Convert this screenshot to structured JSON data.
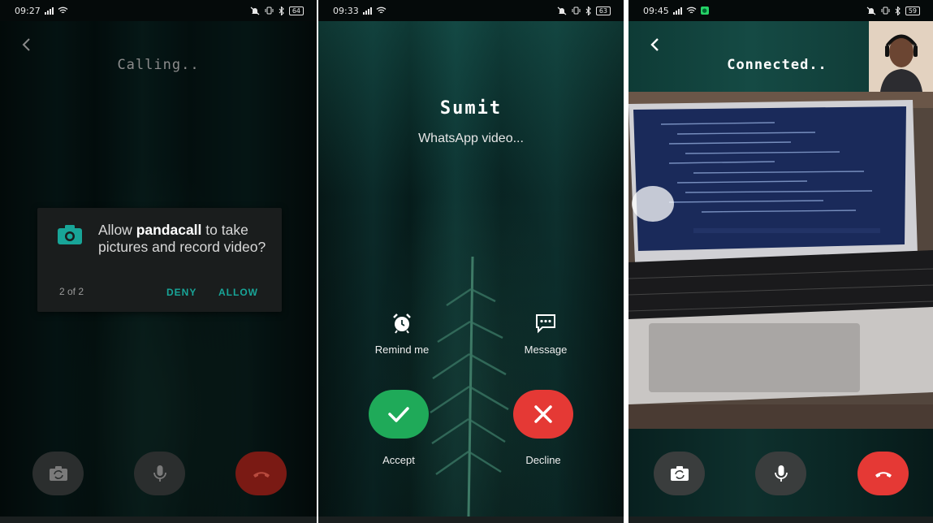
{
  "screens": [
    {
      "status": {
        "time": "09:27",
        "battery": "64"
      },
      "call_status": "Calling..",
      "permission_dialog": {
        "text_before": "Allow ",
        "app_name": "pandacall",
        "text_after": " to take pictures and record video?",
        "counter": "2 of 2",
        "deny_label": "DENY",
        "allow_label": "ALLOW"
      },
      "controls": [
        "flip-camera-icon",
        "microphone-icon",
        "end-call-icon"
      ]
    },
    {
      "status": {
        "time": "09:33",
        "battery": "63"
      },
      "caller_name": "Sumit",
      "call_type": "WhatsApp video...",
      "remind_label": "Remind me",
      "message_label": "Message",
      "accept_label": "Accept",
      "decline_label": "Decline"
    },
    {
      "status": {
        "time": "09:45",
        "battery": "59"
      },
      "call_status": "Connected..",
      "controls": [
        "flip-camera-icon",
        "microphone-icon",
        "end-call-icon"
      ]
    }
  ],
  "colors": {
    "accent": "#18a598",
    "accept": "#1faa59",
    "decline": "#e53935",
    "end_call_dim": "#7a1a14"
  }
}
